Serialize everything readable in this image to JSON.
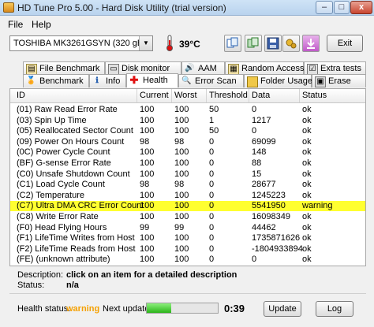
{
  "window": {
    "title": "HD Tune Pro 5.00 - Hard Disk Utility (trial version)",
    "minimize": "–",
    "maximize": "□",
    "close": "x"
  },
  "menu": [
    "File",
    "Help"
  ],
  "drive": {
    "selected": "TOSHIBA MK3261GSYN (320 gB)"
  },
  "temperature": "39°C",
  "toolbar": {
    "exit_label": "Exit"
  },
  "tabs_row1": [
    "File Benchmark",
    "Disk monitor",
    "AAM",
    "Random Access",
    "Extra tests"
  ],
  "tabs_row2": [
    "Benchmark",
    "Info",
    "Health",
    "Error Scan",
    "Folder Usage",
    "Erase"
  ],
  "active_tab": "Health",
  "table": {
    "headers": [
      "ID",
      "Current",
      "Worst",
      "Threshold",
      "Data",
      "Status"
    ],
    "rows": [
      {
        "id": "(01) Raw Read Error Rate",
        "current": "100",
        "worst": "100",
        "threshold": "50",
        "data": "0",
        "status": "ok"
      },
      {
        "id": "(03) Spin Up Time",
        "current": "100",
        "worst": "100",
        "threshold": "1",
        "data": "1217",
        "status": "ok"
      },
      {
        "id": "(05) Reallocated Sector Count",
        "current": "100",
        "worst": "100",
        "threshold": "50",
        "data": "0",
        "status": "ok"
      },
      {
        "id": "(09) Power On Hours Count",
        "current": "98",
        "worst": "98",
        "threshold": "0",
        "data": "69099",
        "status": "ok"
      },
      {
        "id": "(0C) Power Cycle Count",
        "current": "100",
        "worst": "100",
        "threshold": "0",
        "data": "148",
        "status": "ok"
      },
      {
        "id": "(BF) G-sense Error Rate",
        "current": "100",
        "worst": "100",
        "threshold": "0",
        "data": "88",
        "status": "ok"
      },
      {
        "id": "(C0) Unsafe Shutdown Count",
        "current": "100",
        "worst": "100",
        "threshold": "0",
        "data": "15",
        "status": "ok"
      },
      {
        "id": "(C1) Load Cycle Count",
        "current": "98",
        "worst": "98",
        "threshold": "0",
        "data": "28677",
        "status": "ok"
      },
      {
        "id": "(C2) Temperature",
        "current": "100",
        "worst": "100",
        "threshold": "0",
        "data": "1245223",
        "status": "ok"
      },
      {
        "id": "(C7) Ultra DMA CRC Error Count",
        "current": "100",
        "worst": "100",
        "threshold": "0",
        "data": "5541950",
        "status": "warning"
      },
      {
        "id": "(C8) Write Error Rate",
        "current": "100",
        "worst": "100",
        "threshold": "0",
        "data": "16098349",
        "status": "ok"
      },
      {
        "id": "(F0) Head Flying Hours",
        "current": "99",
        "worst": "99",
        "threshold": "0",
        "data": "44462",
        "status": "ok"
      },
      {
        "id": "(F1) LifeTime Writes from Host",
        "current": "100",
        "worst": "100",
        "threshold": "0",
        "data": "1735871626",
        "status": "ok"
      },
      {
        "id": "(F2) LifeTime Reads from Host",
        "current": "100",
        "worst": "100",
        "threshold": "0",
        "data": "-1804933894",
        "status": "ok"
      },
      {
        "id": "(FE) (unknown attribute)",
        "current": "100",
        "worst": "100",
        "threshold": "0",
        "data": "0",
        "status": "ok"
      }
    ]
  },
  "description": {
    "desc_label": "Description:",
    "desc_value": "click on an item for a detailed description",
    "status_label": "Status:",
    "status_value": "n/a"
  },
  "bottom": {
    "health_label": "Health status:",
    "health_value": "warning",
    "next_update_label": "Next update:",
    "next_update_value": "0:39",
    "update_progress": 0.35,
    "update_button": "Update",
    "log_button": "Log"
  },
  "colors": {
    "warning_row": "#ffff30",
    "warning_text": "#f5a000"
  }
}
